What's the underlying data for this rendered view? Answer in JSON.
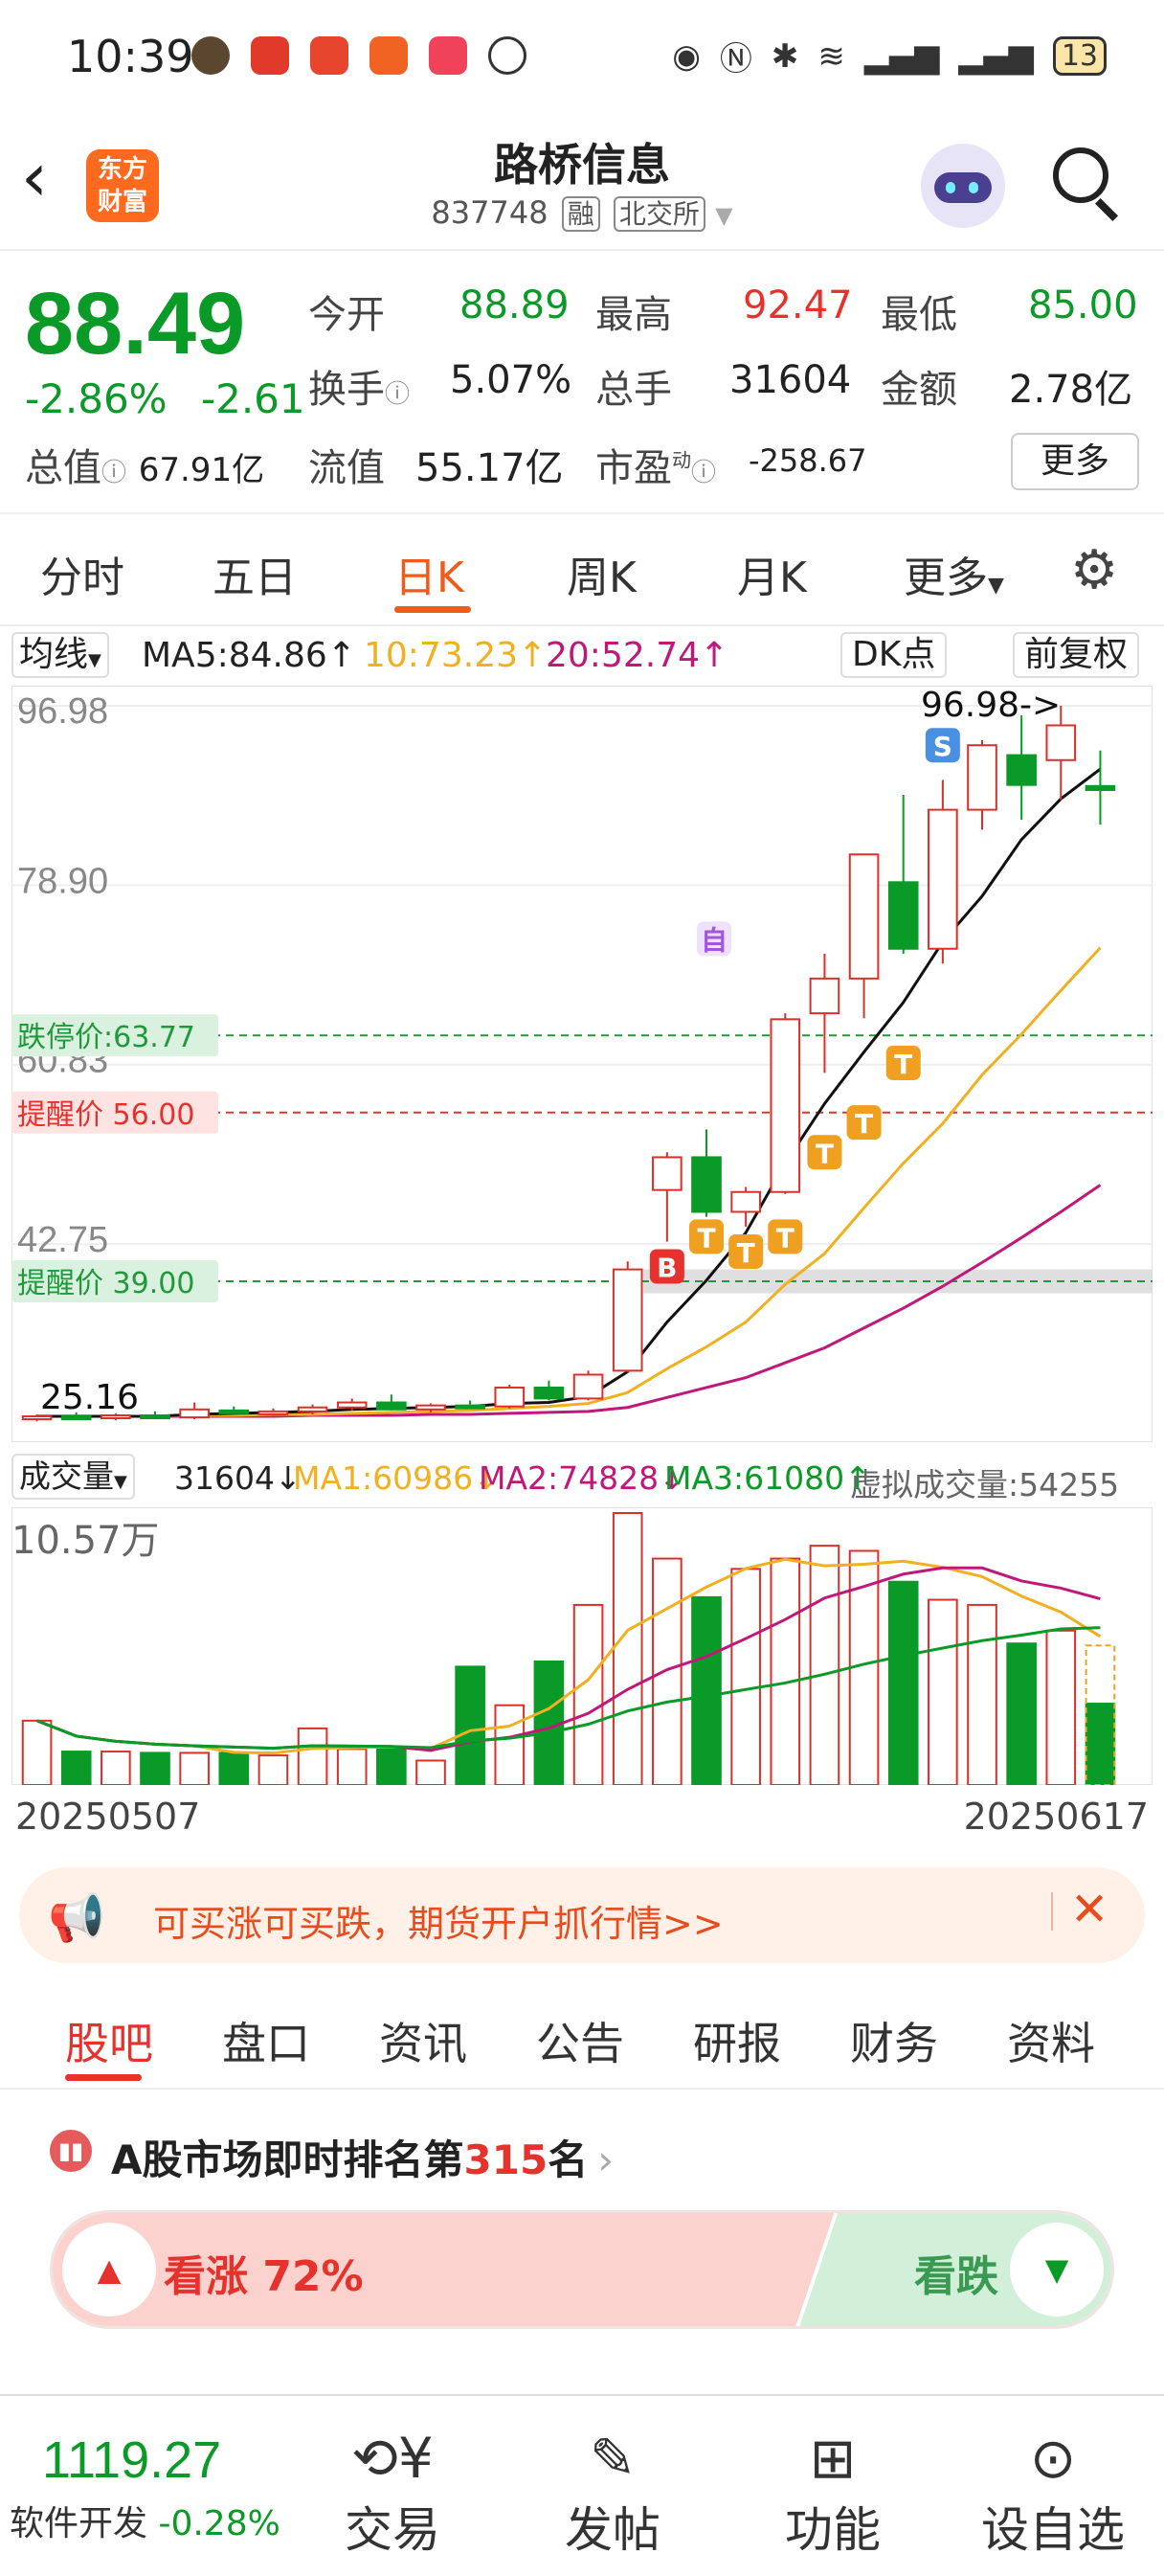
{
  "status_bar": {
    "time": "10:39",
    "battery": "13"
  },
  "header": {
    "title": "路桥信息",
    "code": "837748",
    "tag1": "融",
    "tag2": "北交所",
    "logo_line1": "东方",
    "logo_line2": "财富"
  },
  "quote": {
    "price": "88.49",
    "change_pct": "-2.86%",
    "change": "-2.61",
    "open_label": "今开",
    "open": "88.89",
    "high_label": "最高",
    "high": "92.47",
    "low_label": "最低",
    "low": "85.00",
    "turnover_label": "换手",
    "turnover": "5.07%",
    "volume_label": "总手",
    "volume": "31604",
    "amount_label": "金额",
    "amount": "2.78亿",
    "mktcap_label": "总值",
    "mktcap": "67.91亿",
    "float_label": "流值",
    "float": "55.17亿",
    "pe_label": "市盈",
    "pe_sup": "动",
    "pe": "-258.67",
    "more": "更多"
  },
  "tabs": [
    "分时",
    "五日",
    "日K",
    "周K",
    "月K",
    "更多"
  ],
  "ma_row": {
    "label": "均线",
    "ma5": "MA5:84.86↑",
    "ma10": "10:73.23↑",
    "ma20": "20:52.74↑",
    "dk": "DK点",
    "fq": "前复权"
  },
  "chart_data": {
    "type": "candlestick",
    "y_ticks": [
      "96.98",
      "78.90",
      "60.83",
      "42.75"
    ],
    "high_label": "96.98->",
    "low_label": "25.16",
    "lines": [
      {
        "label": "跌停价:63.77",
        "value": 63.77,
        "color": "#1f9a3a"
      },
      {
        "label": "提醒价 56.00",
        "value": 56.0,
        "color": "#e5322d"
      },
      {
        "label": "提醒价 39.00",
        "value": 39.0,
        "color": "#1f9a3a"
      }
    ],
    "candles": [
      [
        25.2,
        25.6,
        24.9,
        25.4
      ],
      [
        25.4,
        25.8,
        25.1,
        25.3
      ],
      [
        25.3,
        25.7,
        25.0,
        25.5
      ],
      [
        25.5,
        25.9,
        25.2,
        25.3
      ],
      [
        25.3,
        26.8,
        25.1,
        26.1
      ],
      [
        26.0,
        26.4,
        25.7,
        25.8
      ],
      [
        25.8,
        26.2,
        25.5,
        25.9
      ],
      [
        25.9,
        26.6,
        25.6,
        26.3
      ],
      [
        26.3,
        27.2,
        26.0,
        26.8
      ],
      [
        26.8,
        27.6,
        26.0,
        26.1
      ],
      [
        26.1,
        26.7,
        25.8,
        26.5
      ],
      [
        26.5,
        27.0,
        26.2,
        26.4
      ],
      [
        26.4,
        28.6,
        26.2,
        28.3
      ],
      [
        28.3,
        29.0,
        27.0,
        27.2
      ],
      [
        27.2,
        30.0,
        27.0,
        29.6
      ],
      [
        30.0,
        41.0,
        29.8,
        40.2
      ],
      [
        48.2,
        52.0,
        43.0,
        51.5
      ],
      [
        51.5,
        54.3,
        45.5,
        46.0
      ],
      [
        46.0,
        48.5,
        44.5,
        48.0
      ],
      [
        48.0,
        66.0,
        47.8,
        65.4
      ],
      [
        66.0,
        72.0,
        60.0,
        69.5
      ],
      [
        69.5,
        82.0,
        65.5,
        82.0
      ],
      [
        79.2,
        88.0,
        72.0,
        72.5
      ],
      [
        72.5,
        89.5,
        71.0,
        86.5
      ],
      [
        86.5,
        93.5,
        84.5,
        93.0
      ],
      [
        92.0,
        96.0,
        85.5,
        89.0
      ],
      [
        91.5,
        96.98,
        87.5,
        95.0
      ],
      [
        88.89,
        92.47,
        85.0,
        88.49
      ]
    ],
    "ma5": [
      25.4,
      25.4,
      25.4,
      25.4,
      25.6,
      25.7,
      25.8,
      25.9,
      26.1,
      26.2,
      26.3,
      26.4,
      26.7,
      26.8,
      27.4,
      29.9,
      34.9,
      39.1,
      43.9,
      50.9,
      56.9,
      62.1,
      67.1,
      73.2,
      77.8,
      83.5,
      87.6,
      90.6
    ],
    "ma10": [
      25.4,
      25.4,
      25.4,
      25.4,
      25.5,
      25.5,
      25.6,
      25.6,
      25.7,
      25.8,
      25.9,
      26.0,
      26.2,
      26.4,
      26.7,
      27.8,
      30.2,
      32.4,
      34.9,
      38.7,
      41.8,
      46.4,
      50.9,
      54.9,
      59.8,
      63.9,
      68.3,
      72.6
    ],
    "ma20": [
      25.4,
      25.4,
      25.4,
      25.4,
      25.4,
      25.4,
      25.4,
      25.5,
      25.5,
      25.5,
      25.6,
      25.6,
      25.7,
      25.8,
      25.9,
      26.3,
      27.3,
      28.3,
      29.3,
      30.8,
      32.3,
      34.3,
      36.3,
      38.5,
      40.9,
      43.4,
      46.0,
      48.7
    ],
    "markers": [
      "B",
      "T",
      "T",
      "T",
      "T",
      "T",
      "T",
      "S",
      "自"
    ]
  },
  "vol_row": {
    "label": "成交量",
    "vol": "31604↓",
    "ma1": "MA1:60986↓",
    "ma2": "MA2:74828↓",
    "ma3": "MA3:61080↑",
    "virtual": "虚拟成交量:54255",
    "max": "10.57万"
  },
  "volume_data": [
    25000,
    13000,
    13000,
    12500,
    12500,
    12500,
    11500,
    22000,
    14000,
    14000,
    9500,
    46000,
    31000,
    48000,
    70000,
    105700,
    88000,
    73000,
    84000,
    88000,
    93000,
    91000,
    79000,
    72000,
    70000,
    55000,
    60000,
    31604
  ],
  "dates": {
    "start": "20250507",
    "end": "20250617"
  },
  "banner": {
    "text": "可买涨可买跌，期货开户抓行情>>"
  },
  "bottom_tabs": [
    "股吧",
    "盘口",
    "资讯",
    "公告",
    "研报",
    "财务",
    "资料"
  ],
  "rank": {
    "prefix": "A股市场即时排名第",
    "num": "315",
    "suffix": "名",
    "up": "看涨 72%",
    "down": "看跌",
    "up_pct": 72
  },
  "bottom_bar": {
    "index": "1119.27",
    "sector": "软件开发",
    "sector_chg": "-0.28%",
    "items": [
      "交易",
      "发帖",
      "功能",
      "设自选"
    ]
  },
  "colors": {
    "up": "#e5322d",
    "down": "#0a9a27",
    "accent": "#f05a1a"
  }
}
